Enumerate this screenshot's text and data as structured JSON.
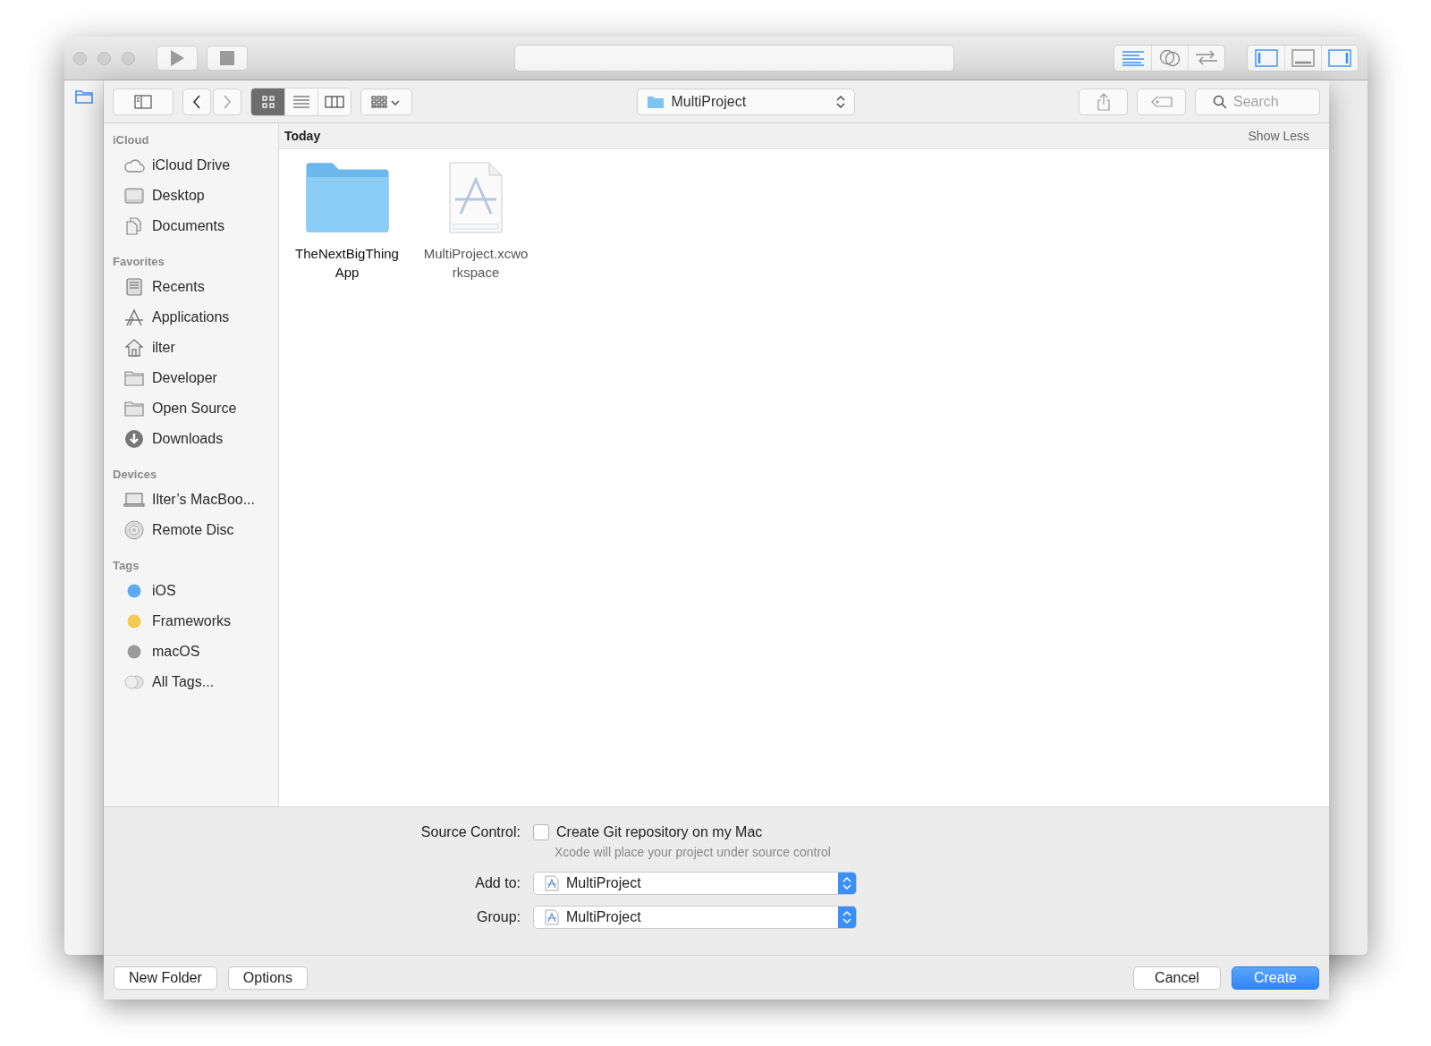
{
  "window": {
    "editor_modes": [
      {
        "selected": true
      },
      {
        "selected": false
      },
      {
        "selected": false
      }
    ],
    "panels": [
      {
        "on": true
      },
      {
        "on": false
      },
      {
        "on": true
      }
    ]
  },
  "sheet": {
    "toolbar": {
      "view_modes": [
        {
          "selected": true
        },
        {
          "selected": false
        },
        {
          "selected": false
        }
      ],
      "location": "MultiProject",
      "search": {
        "placeholder": "Search"
      }
    },
    "sidebar": [
      {
        "title": "iCloud",
        "items": [
          {
            "kind": "place",
            "label": "iCloud Drive"
          },
          {
            "kind": "place",
            "label": "Desktop"
          },
          {
            "kind": "place",
            "label": "Documents"
          }
        ]
      },
      {
        "title": "Favorites",
        "items": [
          {
            "kind": "place",
            "label": "Recents"
          },
          {
            "kind": "place",
            "label": "Applications"
          },
          {
            "kind": "place",
            "label": "ilter"
          },
          {
            "kind": "place",
            "label": "Developer"
          },
          {
            "kind": "place",
            "label": "Open Source"
          },
          {
            "kind": "place",
            "label": "Downloads"
          }
        ]
      },
      {
        "title": "Devices",
        "items": [
          {
            "kind": "place",
            "label": "Ilter’s MacBoo..."
          },
          {
            "kind": "place",
            "label": "Remote Disc"
          }
        ]
      },
      {
        "title": "Tags",
        "items": [
          {
            "kind": "tag",
            "label": "iOS",
            "color": "#5eaaf0"
          },
          {
            "kind": "tag",
            "label": "Frameworks",
            "color": "#f3ca4f"
          },
          {
            "kind": "tag",
            "label": "macOS",
            "color": "#9a9a9a"
          },
          {
            "kind": "all-tags",
            "label": "All Tags..."
          }
        ]
      }
    ],
    "content": {
      "group": "Today",
      "toggle": "Show Less",
      "files": [
        {
          "kind": "folder",
          "name_lines": [
            "TheNextBigThing",
            "App"
          ]
        },
        {
          "kind": "workspace",
          "name_lines": [
            "MultiProject.xcwo",
            "rkspace"
          ]
        }
      ]
    },
    "options": {
      "source_control": {
        "label": "Source Control:",
        "checkbox": {
          "label": "Create Git repository on my Mac",
          "checked": false
        },
        "hint": "Xcode will place your project under source control"
      },
      "popups": [
        {
          "label": "Add to:",
          "value": "MultiProject"
        },
        {
          "label": "Group:",
          "value": "MultiProject"
        }
      ]
    },
    "buttons_left": [
      "New Folder",
      "Options"
    ],
    "buttons_right": [
      {
        "kind": "default",
        "label": "Cancel"
      },
      {
        "kind": "primary",
        "label": "Create"
      }
    ]
  }
}
